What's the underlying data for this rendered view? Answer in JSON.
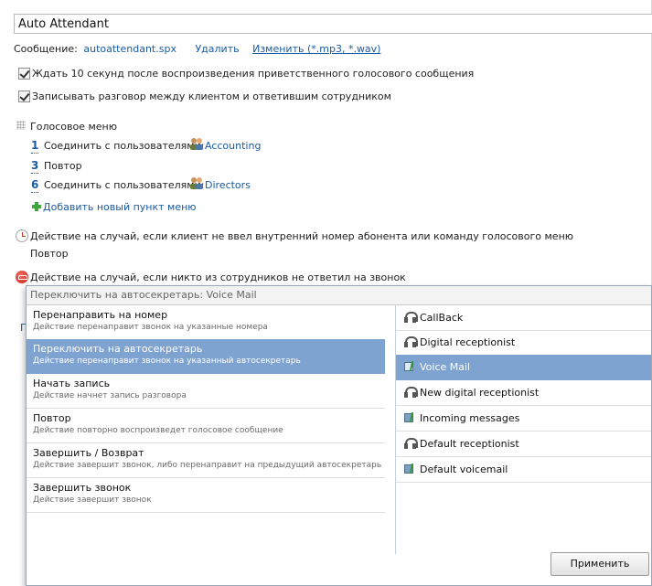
{
  "name_field": {
    "value": "Auto Attendant"
  },
  "message": {
    "label": "Сообщение:",
    "file": "autoattendant.spx",
    "delete": "Удалить",
    "change": "Изменить (*.mp3, *.wav)"
  },
  "options": [
    {
      "label": "Ждать 10 секунд после воспроизведения приветственного голосового сообщения",
      "checked": true
    },
    {
      "label": "Записывать разговор между клиентом и ответившим сотрудником",
      "checked": true
    }
  ],
  "voice_menu": {
    "title": "Голосовое меню",
    "items": [
      {
        "key": "1",
        "action": "Соединить с пользователями:",
        "target": "Accounting"
      },
      {
        "key": "3",
        "action": "Повтор",
        "target": ""
      },
      {
        "key": "6",
        "action": "Соединить с пользователями:",
        "target": "Directors"
      }
    ],
    "add": "Добавить новый пункт меню"
  },
  "no_input": {
    "label": "Действие на случай, если клиент не ввел внутренний номер абонента или команду голосового меню",
    "value": "Повтор"
  },
  "no_answer": {
    "label": "Действие на случай, если никто из сотрудников не ответил на звонок"
  },
  "clipped_letter": "П",
  "popup": {
    "header": "Переключить на автосекретарь: Voice Mail",
    "actions": [
      {
        "title": "Перенаправить на номер",
        "desc": "Действие перенаправит звонок на указанные номера"
      },
      {
        "title": "Переключить на автосекретарь",
        "desc": "Действие перенаправит звонок на указанный автосекретарь",
        "selected": true
      },
      {
        "title": "Начать запись",
        "desc": "Действие начнет запись разговора"
      },
      {
        "title": "Повтор",
        "desc": "Действие повторно воспроизведет голосовое сообщение"
      },
      {
        "title": "Завершить / Возврат",
        "desc": "Действие завершит звонок, либо перенаправит на предыдущий автосекретарь"
      },
      {
        "title": "Завершить звонок",
        "desc": "Действие завершит звонок"
      }
    ],
    "targets": [
      {
        "label": "CallBack",
        "icon": "headset-icon"
      },
      {
        "label": "Digital receptionist",
        "icon": "headset-icon"
      },
      {
        "label": "Voice Mail",
        "icon": "voicemail-icon",
        "selected": true
      },
      {
        "label": "New digital receptionist",
        "icon": "headset-icon"
      },
      {
        "label": "Incoming messages",
        "icon": "voicemail-icon"
      },
      {
        "label": "Default receptionist",
        "icon": "headset-icon"
      },
      {
        "label": "Default voicemail",
        "icon": "voicemail-icon"
      }
    ],
    "apply": "Применить"
  },
  "colors": {
    "link": "#1a5ba6",
    "selection": "#7fa3d0"
  }
}
